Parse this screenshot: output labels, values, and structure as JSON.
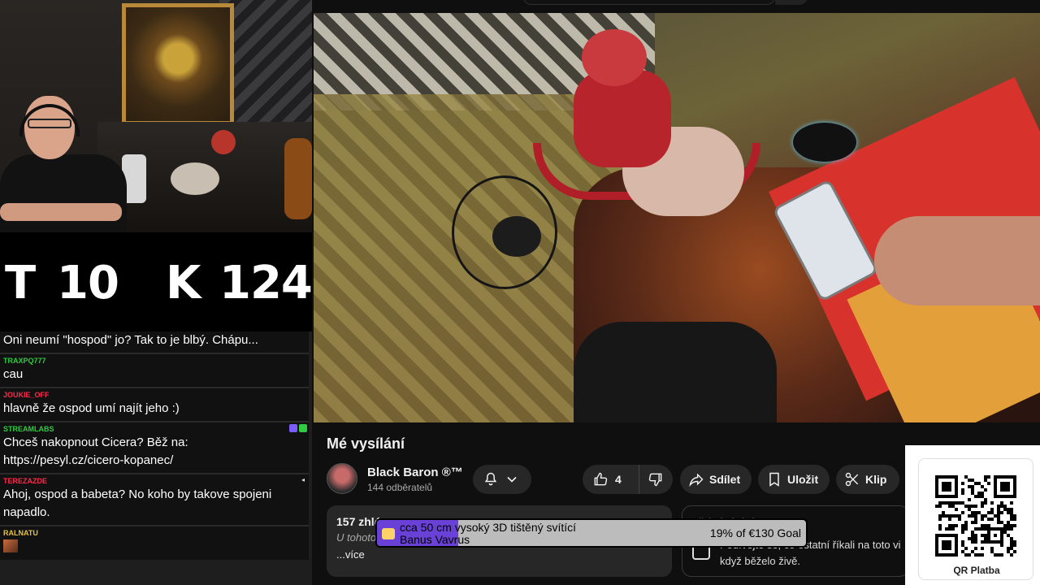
{
  "counter": {
    "t_label": "T",
    "t_value": "10",
    "k_label": "K",
    "k_value": "124"
  },
  "chat": {
    "messages": [
      {
        "user": "",
        "user_color": "#ffffff",
        "text": "Oni neumí \"hospod\" jo? Tak to je blbý. Chápu..."
      },
      {
        "user": "TRAXPQ777",
        "user_color": "#2ecc40",
        "text": "cau"
      },
      {
        "user": "JOUKIE_OFF",
        "user_color": "#ff2a4a",
        "text": "hlavně že ospod umí najít jeho :)"
      },
      {
        "user": "STREAMLABS",
        "user_color": "#2ecc40",
        "text": "Chceš nakopnout Cicera? Běž na: https://pesyl.cz/cicero-kopanec/"
      },
      {
        "user": "TEREZAZDE",
        "user_color": "#ff2a4a",
        "text": "Ahoj, ospod a babeta? No koho by takove spojeni napadlo."
      },
      {
        "user": "RALNATU",
        "user_color": "#e8c43a",
        "text": ""
      }
    ]
  },
  "video": {
    "title": "Mé vysílání"
  },
  "channel": {
    "name": "Black Baron ®™",
    "subscribers": "144 odběratelů"
  },
  "actions": {
    "likes": "4",
    "share_label": "Sdílet",
    "save_label": "Uložit",
    "clip_label": "Klip"
  },
  "description": {
    "views": "157 zhlé",
    "sub": "U tohoto",
    "more": "...více"
  },
  "replay": {
    "title": "Přehrávání chatu",
    "text": "Podívejte se, co ostatní říkali na toto vi když běželo živě."
  },
  "goal": {
    "title": "cca 50 cm vysoký 3D tištěný svítící",
    "subtitle": "Banus Vavrus",
    "amount": "19% of €130 Goal",
    "progress": 0.19,
    "accent": "#6a41d6"
  },
  "qr": {
    "label": "QR Platba"
  },
  "icons": [
    "bell-icon",
    "chevron-down-icon",
    "thumbs-up-icon",
    "thumbs-down-icon",
    "share-icon",
    "bookmark-icon",
    "scissors-icon",
    "chat-replay-icon",
    "qr-code-icon"
  ]
}
